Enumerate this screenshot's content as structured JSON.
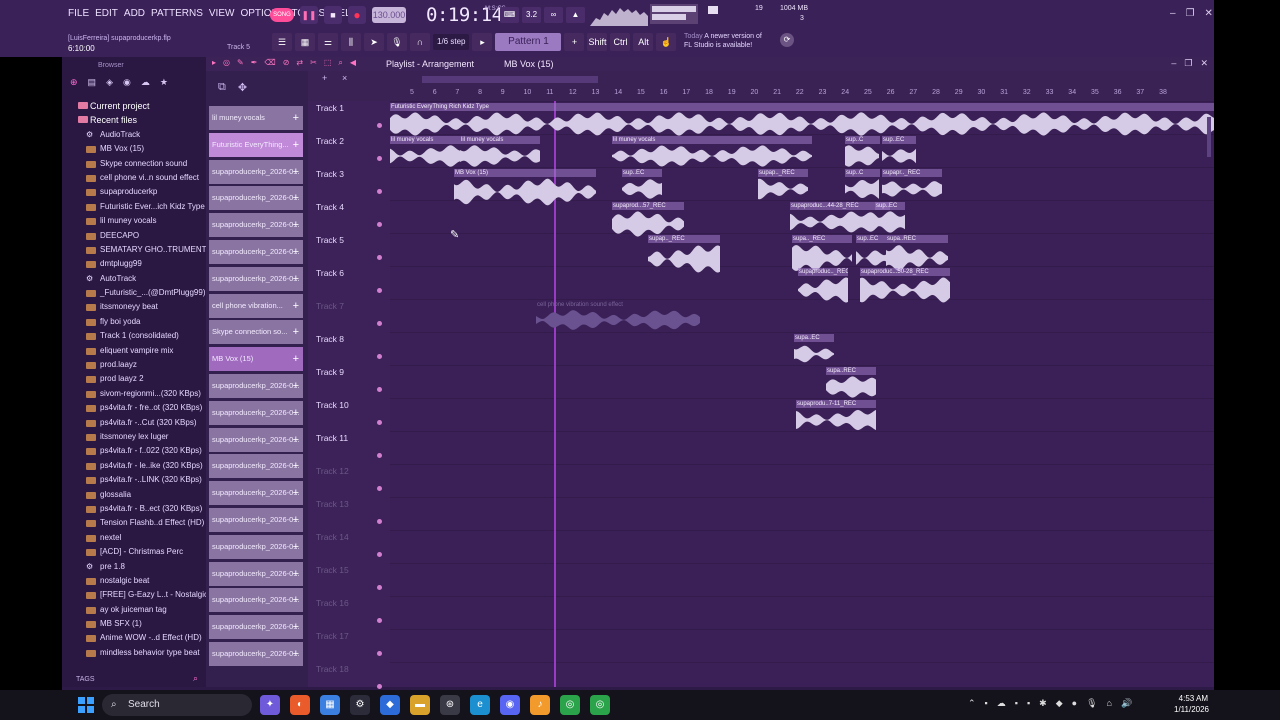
{
  "menu": [
    "FILE",
    "EDIT",
    "ADD",
    "PATTERNS",
    "VIEW",
    "OPTIONS",
    "TOOLS",
    "HELP"
  ],
  "project": {
    "user_file": "[LuisFerreira] supaproducerkp.flp",
    "time": "6:10:00",
    "hint": "Track 5"
  },
  "transport": {
    "song_label": "SONG",
    "tempo": "130.000",
    "clock": "0:19:14",
    "clock_unit": "M:S:CS",
    "snap": "1/6 step",
    "pattern": "Pattern 1"
  },
  "meters": {
    "voices": "19",
    "memory": "1004 MB",
    "cpu": "3"
  },
  "keys": {
    "shift": "Shift",
    "ctrl": "Ctrl",
    "alt": "Alt"
  },
  "news": {
    "today": "Today",
    "line1": "A newer version of",
    "line2": "FL Studio is available!"
  },
  "browser": {
    "title": "Browser",
    "current_project": "Current project",
    "recent_files": "Recent files",
    "items": [
      {
        "label": "AudioTrack",
        "icon": "gear"
      },
      {
        "label": "MB Vox (15)",
        "icon": "wave"
      },
      {
        "label": "Skype connection sound",
        "icon": "wave"
      },
      {
        "label": "cell phone vi..n sound effect",
        "icon": "wave"
      },
      {
        "label": "supaproducerkp",
        "icon": "wave"
      },
      {
        "label": "Futuristic Ever...ich Kidz Type",
        "icon": "wave"
      },
      {
        "label": "lil muney vocals",
        "icon": "wave"
      },
      {
        "label": "DEECAPO",
        "icon": "wave"
      },
      {
        "label": "SEMATARY GHO..TRUMENTAL",
        "icon": "wave"
      },
      {
        "label": "dmtplugg99",
        "icon": "wave"
      },
      {
        "label": "AutoTrack",
        "icon": "gear"
      },
      {
        "label": "_Futuristic_...(@DmtPlugg99)",
        "icon": "wave"
      },
      {
        "label": "itssmoneyy beat",
        "icon": "wave"
      },
      {
        "label": "fly boi yoda",
        "icon": "wave"
      },
      {
        "label": "Track 1 (consolidated)",
        "icon": "wave"
      },
      {
        "label": "eliquent vampire mix",
        "icon": "wave"
      },
      {
        "label": "prod.laayz",
        "icon": "wave"
      },
      {
        "label": "prod laayz 2",
        "icon": "wave"
      },
      {
        "label": "sivom-regionmi...(320 KBps)",
        "icon": "wave"
      },
      {
        "label": "ps4vita.fr - fre..ot (320 KBps)",
        "icon": "wave"
      },
      {
        "label": "ps4vita.fr -..Cut (320 KBps)",
        "icon": "wave"
      },
      {
        "label": "itssmoney lex luger",
        "icon": "wave"
      },
      {
        "label": "ps4vita.fr - f..022 (320 KBps)",
        "icon": "wave"
      },
      {
        "label": "ps4vita.fr - le..ike (320 KBps)",
        "icon": "wave"
      },
      {
        "label": "ps4vita.fr -..LINK (320 KBps)",
        "icon": "wave"
      },
      {
        "label": "glossalia",
        "icon": "wave"
      },
      {
        "label": "ps4vita.fr - B..ect (320 KBps)",
        "icon": "wave"
      },
      {
        "label": "Tension Flashb..d Effect (HD)",
        "icon": "wave"
      },
      {
        "label": "nextel",
        "icon": "wave"
      },
      {
        "label": "[ACD] - Christmas Perc",
        "icon": "wave"
      },
      {
        "label": "pre 1.8",
        "icon": "gear"
      },
      {
        "label": "nostalgic beat",
        "icon": "wave"
      },
      {
        "label": "[FREE] G-Eazy L..t - Nostalgic",
        "icon": "wave"
      },
      {
        "label": "ay ok juiceman tag",
        "icon": "wave"
      },
      {
        "label": "MB SFX (1)",
        "icon": "wave"
      },
      {
        "label": "Anime WOW -..d Effect (HD)",
        "icon": "wave"
      },
      {
        "label": "mindless behavior type beat",
        "icon": "wave"
      }
    ],
    "tags_label": "TAGS"
  },
  "picker": [
    "lil muney vocals",
    "Futuristic EveryThing...",
    "supaproducerkp_2026-0...",
    "supaproducerkp_2026-0...",
    "supaproducerkp_2026-0...",
    "supaproducerkp_2026-0...",
    "supaproducerkp_2026-0...",
    "cell phone vibration...",
    "Skype connection so...",
    "MB Vox (15)",
    "supaproducerkp_2026-0...",
    "supaproducerkp_2026-0...",
    "supaproducerkp_2026-0...",
    "supaproducerkp_2026-0...",
    "supaproducerkp_2026-0...",
    "supaproducerkp_2026-0...",
    "supaproducerkp_2026-0...",
    "supaproducerkp_2026-0...",
    "supaproducerkp_2026-0...",
    "supaproducerkp_2026-0...",
    "supaproducerkp_2026-0..."
  ],
  "playlist": {
    "title": "Playlist - Arrangement",
    "pattern": "MB Vox (15)",
    "ruler": [
      "5",
      "6",
      "7",
      "8",
      "9",
      "10",
      "11",
      "12",
      "13",
      "14",
      "15",
      "16",
      "17",
      "18",
      "19",
      "20",
      "21",
      "22",
      "23",
      "24",
      "25",
      "26",
      "27",
      "28",
      "29",
      "30",
      "31",
      "32",
      "33",
      "34",
      "35",
      "36",
      "37",
      "38"
    ],
    "tracks": [
      "Track 1",
      "Track 2",
      "Track 3",
      "Track 4",
      "Track 5",
      "Track 6",
      "Track 7",
      "Track 8",
      "Track 9",
      "Track 10",
      "Track 11",
      "Track 12",
      "Track 13",
      "Track 14",
      "Track 15",
      "Track 16",
      "Track 17",
      "Track 18"
    ],
    "clips": [
      {
        "label": "Futuristic EveryThing Rich Kidz Type",
        "track": 1
      },
      {
        "label": "lil muney vocals",
        "track": 2
      },
      {
        "label": "lil muney vocals",
        "track": 2
      },
      {
        "label": "lil muney vocals",
        "track": 2
      },
      {
        "label": "sup..C",
        "track": 2
      },
      {
        "label": "sup..EC",
        "track": 2
      },
      {
        "label": "MB Vox (15)",
        "track": 3
      },
      {
        "label": "sup..EC",
        "track": 3
      },
      {
        "label": "supap.._REC",
        "track": 3
      },
      {
        "label": "sup..C",
        "track": 3
      },
      {
        "label": "supapr.._REC",
        "track": 3
      },
      {
        "label": "supaprod...57_REC",
        "track": 4
      },
      {
        "label": "supaproduc...44-28_REC",
        "track": 4
      },
      {
        "label": "sup..EC",
        "track": 4
      },
      {
        "label": "supap.._REC",
        "track": 5
      },
      {
        "label": "supa.._REC",
        "track": 5
      },
      {
        "label": "sup..EC",
        "track": 5
      },
      {
        "label": "supa..REC",
        "track": 5
      },
      {
        "label": "supaproduc.._REC",
        "track": 6
      },
      {
        "label": "supaproduc...50-28_REC",
        "track": 6
      },
      {
        "label": "cell phone vibration sound effect",
        "track": 7
      },
      {
        "label": "supa..EC",
        "track": 8
      },
      {
        "label": "supa..REC",
        "track": 9
      },
      {
        "label": "supaprodu..7-11_REC",
        "track": 10
      }
    ]
  },
  "taskbar": {
    "search": "Search",
    "time": "4:53 AM",
    "date": "1/11/2026"
  }
}
